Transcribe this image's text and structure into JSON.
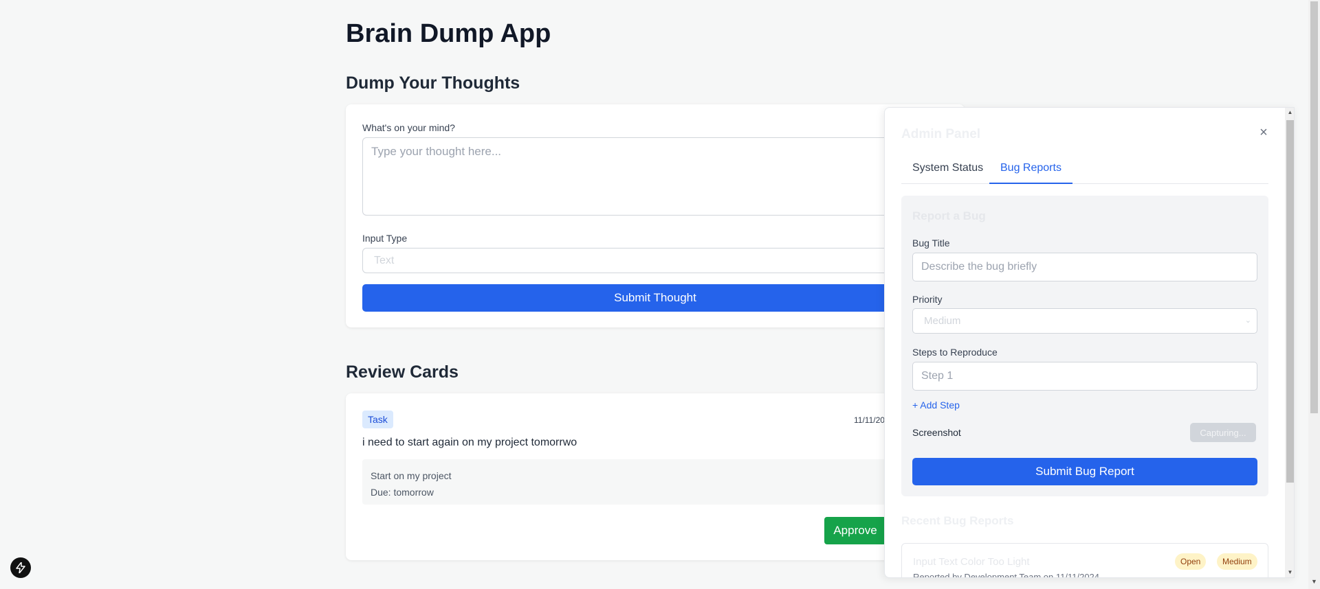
{
  "app": {
    "title": "Brain Dump App"
  },
  "dump": {
    "title": "Dump Your Thoughts",
    "thought_label": "What's on your mind?",
    "thought_placeholder": "Type your thought here...",
    "input_type_label": "Input Type",
    "input_type_placeholder": "Text",
    "submit_label": "Submit Thought"
  },
  "review": {
    "title": "Review Cards",
    "card": {
      "tag": "Task",
      "date": "11/11/20",
      "text": "i need to start again on my project tomorrwo",
      "details": [
        "Start on my project",
        "Due: tomorrow"
      ],
      "approve_label": "Approve"
    }
  },
  "admin": {
    "title": "Admin Panel",
    "close_symbol": "×",
    "tabs": [
      {
        "label": "System Status",
        "active": false
      },
      {
        "label": "Bug Reports",
        "active": true
      }
    ],
    "report": {
      "title": "Report a Bug",
      "bug_title_label": "Bug Title",
      "bug_title_placeholder": "Describe the bug briefly",
      "priority_label": "Priority",
      "priority_value": "Medium",
      "steps_label": "Steps to Reproduce",
      "step_placeholder": "Step 1",
      "add_step_label": "+ Add Step",
      "screenshot_label": "Screenshot",
      "capture_label": "Capturing...",
      "submit_label": "Submit Bug Report"
    },
    "recent": {
      "title": "Recent Bug Reports",
      "items": [
        {
          "title": "Input Text Color Too Light",
          "meta": "Reported by Development Team on 11/11/2024",
          "status": "Open",
          "priority": "Medium"
        }
      ]
    }
  },
  "colors": {
    "primary": "#2563eb",
    "approve": "#16a34a",
    "background": "#f6f7f7",
    "pill_bg": "#fef3c7"
  },
  "icons": {
    "dev_indicator": "lightning-icon",
    "close": "close-icon",
    "chevron": "chevron-down-icon"
  }
}
